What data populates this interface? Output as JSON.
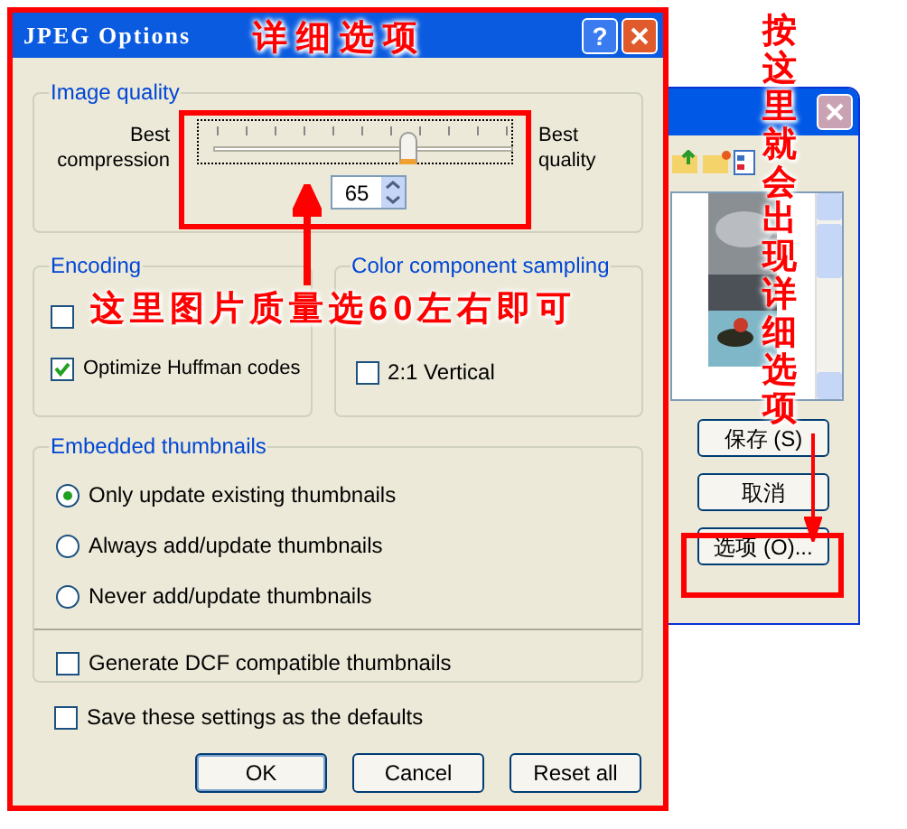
{
  "dialog": {
    "title": "JPEG Options",
    "help": "?",
    "image_quality": {
      "label": "Image quality",
      "left_label": "Best compression",
      "right_label": "Best quality",
      "level": 0.65,
      "value": "65"
    },
    "encoding": {
      "label": "Encoding",
      "options": [
        {
          "checked": false
        },
        {
          "label": "Optimize Huffman codes",
          "checked": true
        }
      ]
    },
    "color_sampling": {
      "label": "Color component sampling",
      "options": [
        {
          "label": "2:1 Vertical",
          "checked": false
        }
      ]
    },
    "thumbnails": {
      "label": "Embedded thumbnails",
      "options": [
        {
          "label": "Only update existing thumbnails",
          "selected": true
        },
        {
          "label": "Always add/update thumbnails",
          "selected": false
        },
        {
          "label": "Never add/update thumbnails",
          "selected": false
        }
      ],
      "dcf": {
        "label": "Generate DCF compatible thumbnails",
        "checked": false
      }
    },
    "save_defaults": {
      "label": "Save these settings as the defaults",
      "checked": false
    },
    "buttons": [
      "OK",
      "Cancel",
      "Reset all"
    ]
  },
  "background_window": {
    "buttons": [
      "保存 (S)",
      "取消",
      "选项 (O)..."
    ]
  },
  "annotations": [
    {
      "kind": "title",
      "text": "详细选项"
    },
    {
      "kind": "horizontal",
      "text": "这里图片质量选60左右即可"
    },
    {
      "kind": "vertical",
      "text": "按这里就会出现详细选项"
    }
  ]
}
